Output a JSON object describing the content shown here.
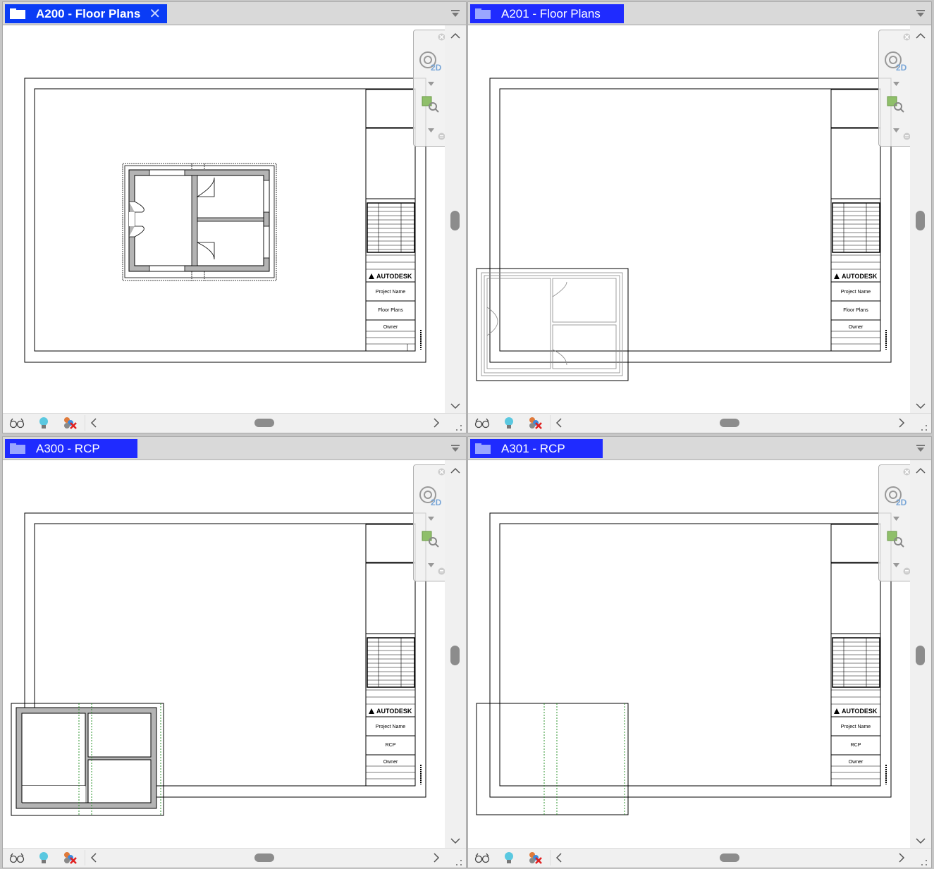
{
  "views": [
    {
      "tab_title": "A200 - Floor Plans",
      "active": true,
      "close_glyph": "✕",
      "title_block": {
        "brand": "AUTODESK",
        "project_name": "Project Name",
        "sheet_name": "Floor Plans",
        "owner": "Owner"
      }
    },
    {
      "tab_title": "A201 - Floor Plans",
      "active": false,
      "title_block": {
        "brand": "AUTODESK",
        "project_name": "Project Name",
        "sheet_name": "Floor Plans",
        "owner": "Owner"
      }
    },
    {
      "tab_title": "A300 - RCP",
      "active": false,
      "title_block": {
        "brand": "AUTODESK",
        "project_name": "Project Name",
        "sheet_name": "RCP",
        "owner": "Owner"
      }
    },
    {
      "tab_title": "A301 - RCP",
      "active": false,
      "title_block": {
        "brand": "AUTODESK",
        "project_name": "Project Name",
        "sheet_name": "RCP",
        "owner": "Owner"
      }
    }
  ],
  "navbar": {
    "wheel_badge": "2D"
  },
  "colors": {
    "active_tab": "#0a3cf5",
    "inactive_tab": "#1f2bff",
    "scroll_thumb": "#8c8c8c",
    "wall_fill": "#b4b4b4",
    "ceiling_grid": "#1a8a1a"
  },
  "icons": [
    "document-icon",
    "close-icon",
    "menu-arrow-icon",
    "steering-wheel-icon",
    "zoom-region-icon",
    "scroll-up-icon",
    "scroll-down-icon",
    "scroll-left-icon",
    "scroll-right-icon",
    "visual-style-icon",
    "light-bulb-icon",
    "hide-elements-icon",
    "resize-grip-icon"
  ]
}
